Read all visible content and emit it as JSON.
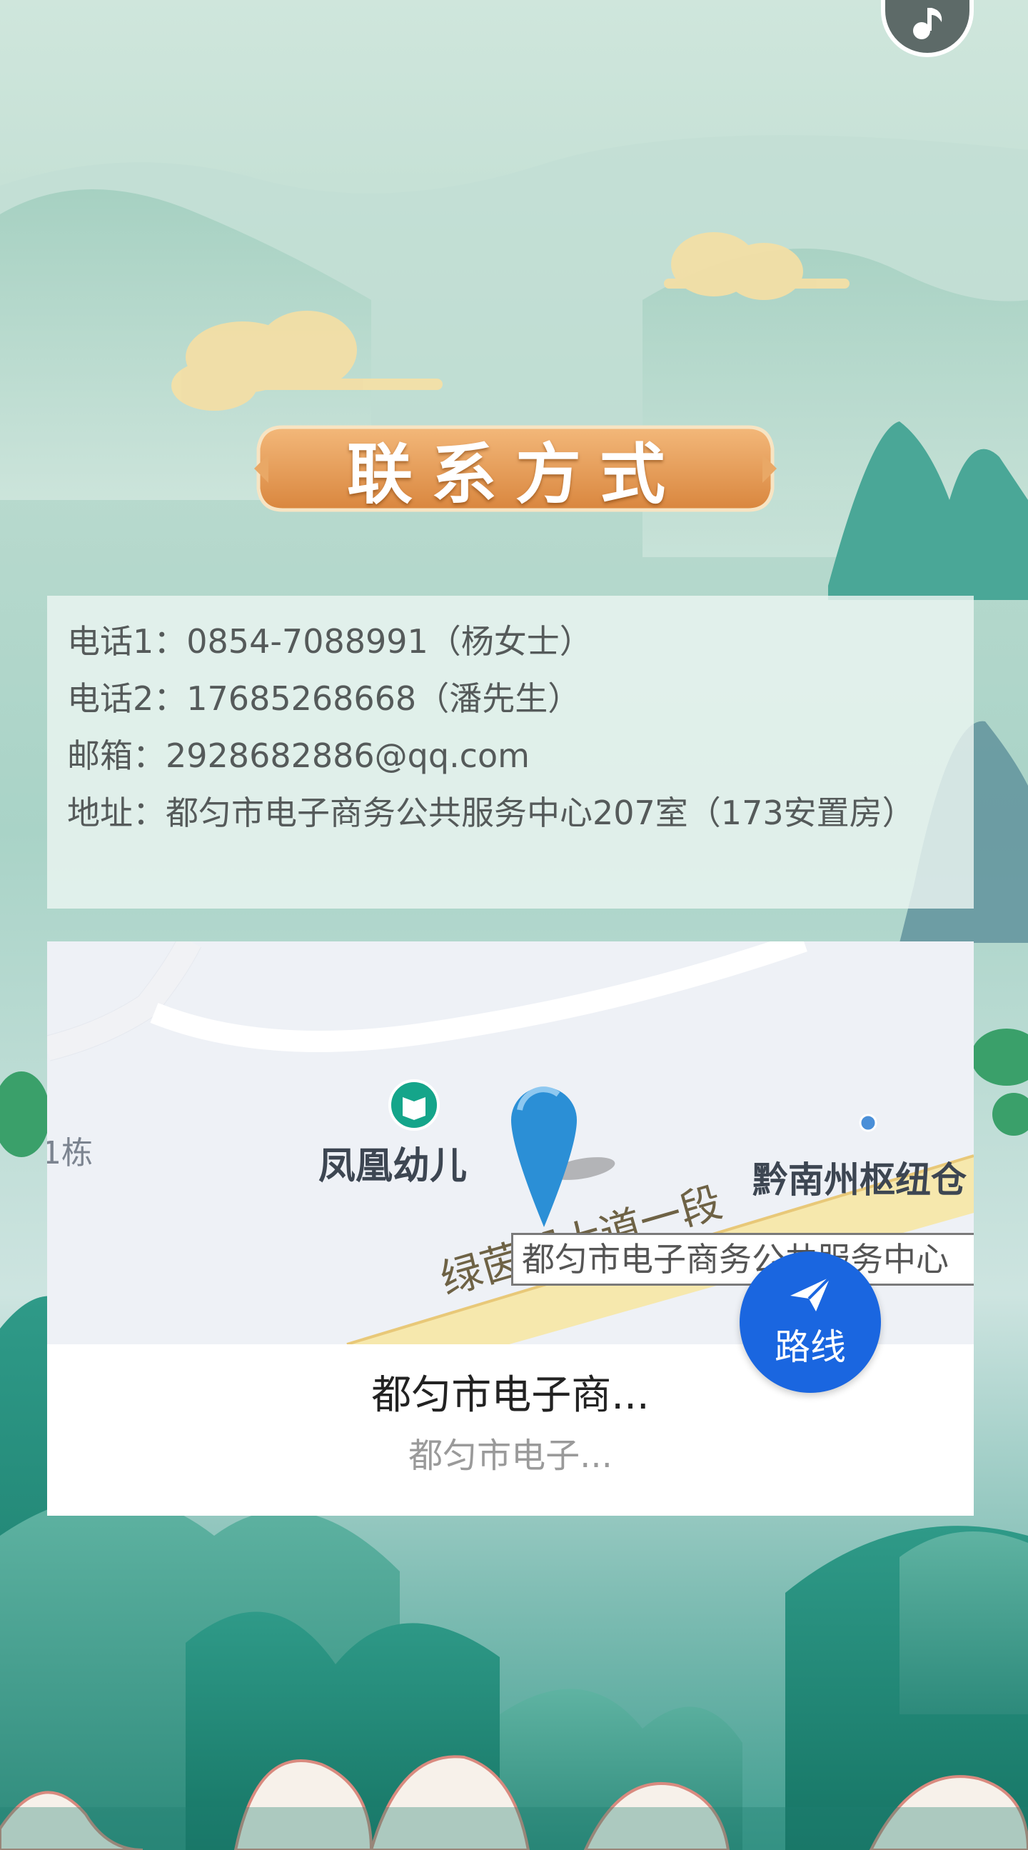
{
  "header": {
    "title": "联系方式",
    "music_icon": "music-note-icon"
  },
  "contact": {
    "phone1": "电话1：0854-7088991（杨女士）",
    "phone2": "电话2：17685268668（潘先生）",
    "email": "邮箱：2928682886@qq.com",
    "address": "地址：都匀市电子商务公共服务中心207室（173安置房）"
  },
  "map": {
    "labels": {
      "building": "1栋",
      "kindergarten": "凤凰幼儿",
      "hub": "黔南州枢纽仓",
      "road": "绿茵湖大道一段"
    },
    "callout": "都匀市电子商务公共服务中心",
    "route_button": "路线",
    "place_name": "都匀市电子商...",
    "place_subtitle": "都匀市电子..."
  },
  "colors": {
    "route_blue": "#1a66e0",
    "banner_orange": "#e0924a",
    "pin_blue": "#2b8fd6"
  }
}
